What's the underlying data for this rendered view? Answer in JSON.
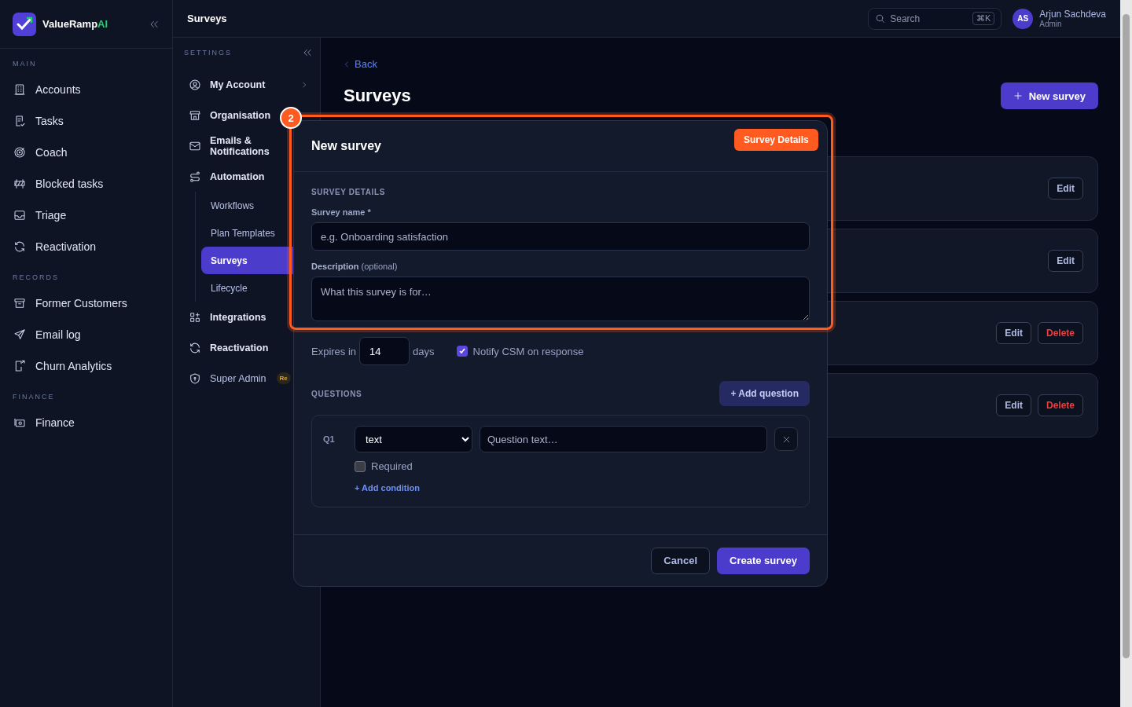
{
  "brand": {
    "name": "ValueRamp",
    "accent": "AI"
  },
  "sidebar": {
    "sections": [
      {
        "label": "MAIN",
        "items": [
          {
            "label": "Accounts"
          },
          {
            "label": "Tasks"
          },
          {
            "label": "Coach"
          },
          {
            "label": "Blocked tasks"
          },
          {
            "label": "Triage"
          },
          {
            "label": "Reactivation"
          }
        ]
      },
      {
        "label": "RECORDS",
        "items": [
          {
            "label": "Former Customers"
          },
          {
            "label": "Email log"
          },
          {
            "label": "Churn Analytics"
          }
        ]
      },
      {
        "label": "FINANCE",
        "items": [
          {
            "label": "Finance"
          }
        ]
      }
    ]
  },
  "topbar": {
    "title": "Surveys",
    "search": {
      "placeholder": "Search",
      "shortcut": "⌘K"
    },
    "user": {
      "initials": "AS",
      "name": "Arjun Sachdeva",
      "role": "Admin"
    }
  },
  "settings": {
    "label": "SETTINGS",
    "items": [
      {
        "label": "My Account",
        "selected": false,
        "chevron": true
      },
      {
        "label": "Organisation",
        "selected": false
      },
      {
        "label": "Emails & Notifications",
        "selected": false
      },
      {
        "label": "Automation",
        "selected": false,
        "children": [
          {
            "label": "Workflows",
            "selected": false
          },
          {
            "label": "Plan Templates",
            "selected": false
          },
          {
            "label": "Surveys",
            "selected": true
          },
          {
            "label": "Lifecycle",
            "selected": false
          }
        ]
      },
      {
        "label": "Integrations",
        "selected": false
      },
      {
        "label": "Reactivation",
        "selected": false
      },
      {
        "label": "Super Admin",
        "selected": false,
        "badge": "Re"
      }
    ]
  },
  "main": {
    "back": "Back",
    "title": "Surveys",
    "new_button": "New survey",
    "cards": [
      {
        "actions": [
          {
            "label": "Edit",
            "kind": "edit"
          }
        ]
      },
      {
        "actions": [
          {
            "label": "Edit",
            "kind": "edit"
          }
        ]
      },
      {
        "actions": [
          {
            "label": "Edit",
            "kind": "edit"
          },
          {
            "label": "Delete",
            "kind": "delete"
          }
        ]
      },
      {
        "actions": [
          {
            "label": "Edit",
            "kind": "edit"
          },
          {
            "label": "Delete",
            "kind": "delete"
          }
        ]
      }
    ]
  },
  "modal": {
    "title": "New survey",
    "section": "SURVEY DETAILS",
    "name_label": "Survey name *",
    "name_placeholder": "e.g. Onboarding satisfaction",
    "description_label": "**Description** (optional)",
    "description_placeholder": "What this survey is for…",
    "expires_label": "Expires in",
    "expires_value": "14",
    "expires_unit": "days",
    "notify": {
      "label": "Notify CSM on response",
      "checked": true
    },
    "questions_label": "QUESTIONS",
    "add_question": "+ Add question",
    "questions": [
      {
        "number": "Q1",
        "type": "text",
        "placeholder": "Question text…",
        "required": {
          "label": "Required",
          "checked": false
        },
        "add_condition": "+ Add condition"
      }
    ],
    "cancel": "Cancel",
    "create": "Create survey"
  },
  "annotation": {
    "number": "2",
    "label": "Survey Details"
  }
}
